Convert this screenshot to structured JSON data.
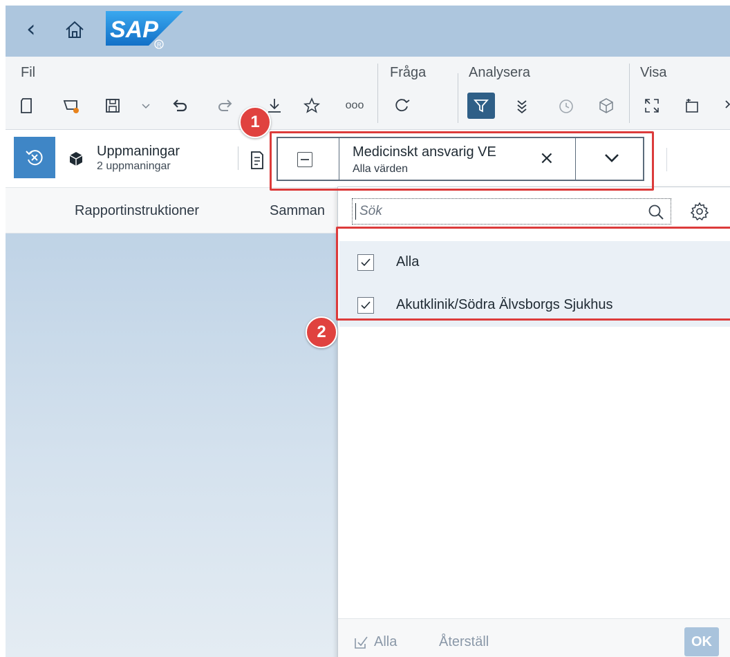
{
  "shell": {
    "logo_text": "SAP",
    "brand_color": "#1b8bd9"
  },
  "toolbar": {
    "groups": [
      "Fil",
      "Fråga",
      "Analysera",
      "Visa"
    ],
    "more_label": "ooo"
  },
  "prompts": {
    "title": "Uppmaningar",
    "count": "2 uppmaningar"
  },
  "filter_token": {
    "title": "Medicinskt ansvarig VE",
    "subtitle": "Alla värden",
    "clear": "×"
  },
  "tabs": [
    "Rapportinstruktioner",
    "Samman"
  ],
  "value_help": {
    "search_placeholder": "Sök",
    "items": [
      {
        "label": "Alla",
        "checked": true
      },
      {
        "label": "Akutklinik/Södra Älvsborgs Sjukhus",
        "checked": true
      }
    ],
    "footer": {
      "select_all": "Alla",
      "reset": "Återställ",
      "ok": "OK"
    }
  },
  "annotations": {
    "badge_1": "1",
    "badge_2": "2",
    "color": "#dc3b3b"
  }
}
